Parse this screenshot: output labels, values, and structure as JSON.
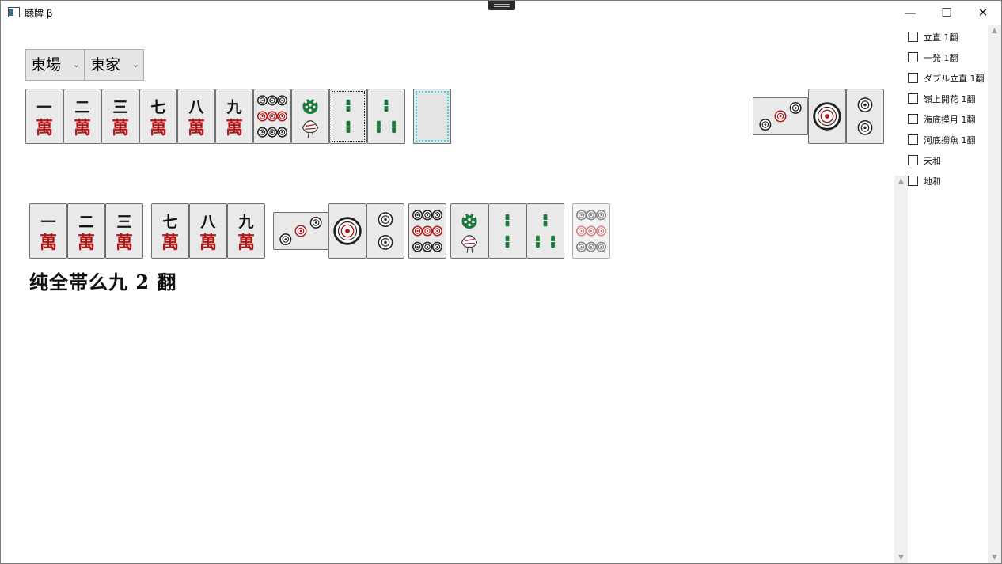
{
  "window": {
    "title": "聴牌 β",
    "min": "—",
    "max": "☐",
    "close": "✕"
  },
  "selectors": {
    "round": "東場",
    "seat": "東家",
    "chevron": "⌄"
  },
  "yaku": [
    {
      "label": "立直 1翻",
      "checked": false
    },
    {
      "label": "一発 1翻",
      "checked": false
    },
    {
      "label": "ダブル立直 1翻",
      "checked": false
    },
    {
      "label": "嶺上開花 1翻",
      "checked": false
    },
    {
      "label": "海底摸月 1翻",
      "checked": false
    },
    {
      "label": "河底撈魚 1翻",
      "checked": false
    },
    {
      "label": "天和",
      "checked": false
    },
    {
      "label": "地和",
      "checked": false
    }
  ],
  "hand": {
    "tiles": [
      "一萬",
      "二萬",
      "三萬",
      "七萬",
      "八萬",
      "九萬",
      "9p",
      "1s",
      "2s",
      "3s"
    ],
    "draw_slot": ""
  },
  "meld": {
    "tiles": [
      "3p",
      "1p",
      "2p"
    ]
  },
  "result": {
    "groups": [
      [
        "一萬",
        "二萬",
        "三萬"
      ],
      [
        "七萬",
        "八萬",
        "九萬"
      ],
      [
        "3p",
        "1p",
        "2p"
      ],
      [
        "9p"
      ],
      [
        "1s",
        "2s",
        "3s"
      ],
      [
        "9p"
      ]
    ],
    "text": "纯全帯么九 2 翻"
  },
  "colors": {
    "red": "#b01818",
    "green": "#1e7a3c",
    "cyan": "#35d8ea"
  }
}
